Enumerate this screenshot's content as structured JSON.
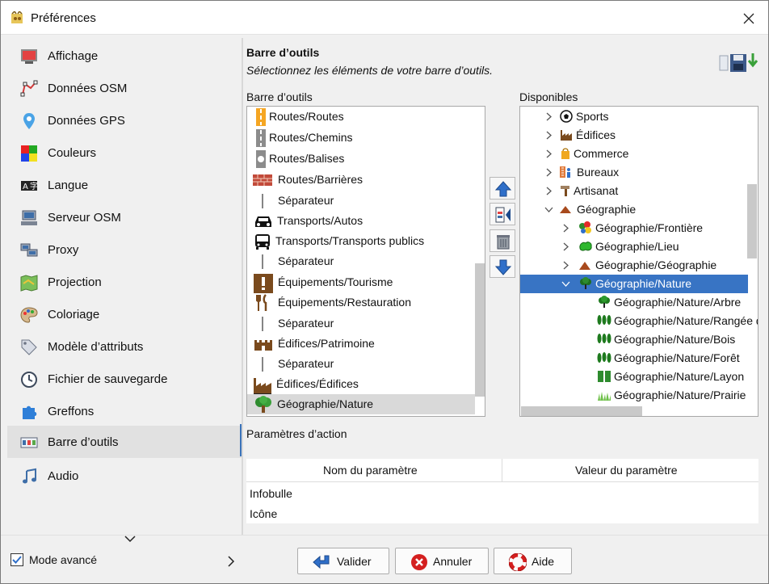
{
  "window": {
    "title": "Préférences"
  },
  "sidebar": {
    "items": [
      {
        "label": "Affichage",
        "icon": "display-icon"
      },
      {
        "label": "Données OSM",
        "icon": "osm-data-icon"
      },
      {
        "label": "Données GPS",
        "icon": "gps-pin-icon"
      },
      {
        "label": "Couleurs",
        "icon": "colors-icon"
      },
      {
        "label": "Langue",
        "icon": "language-icon"
      },
      {
        "label": "Serveur OSM",
        "icon": "server-icon"
      },
      {
        "label": "Proxy",
        "icon": "proxy-icon"
      },
      {
        "label": "Projection",
        "icon": "map-projection-icon"
      },
      {
        "label": "Coloriage",
        "icon": "palette-icon"
      },
      {
        "label": "Modèle d’attributs",
        "icon": "tag-icon"
      },
      {
        "label": "Fichier de sauvegarde",
        "icon": "clock-file-icon"
      },
      {
        "label": "Greffons",
        "icon": "puzzle-icon"
      },
      {
        "label": "Barre d’outils",
        "icon": "toolbar-icon",
        "selected": true
      },
      {
        "label": "Audio",
        "icon": "music-note-icon"
      }
    ]
  },
  "main": {
    "title": "Barre d’outils",
    "subtitle": "Sélectionnez les éléments de votre barre d’outils.",
    "toolbar_label": "Barre d’outils",
    "available_label": "Disponibles",
    "toolbar_items": [
      {
        "label": "Routes/Routes",
        "icon": "road-primary-icon"
      },
      {
        "label": "Routes/Chemins",
        "icon": "road-path-icon"
      },
      {
        "label": "Routes/Balises",
        "icon": "road-marker-icon"
      },
      {
        "label": "Routes/Barrières",
        "icon": "brick-wall-icon"
      },
      {
        "label": "Séparateur",
        "icon": "separator-icon"
      },
      {
        "label": "Transports/Autos",
        "icon": "car-icon"
      },
      {
        "label": "Transports/Transports publics",
        "icon": "bus-icon"
      },
      {
        "label": "Séparateur",
        "icon": "separator-icon"
      },
      {
        "label": "Équipements/Tourisme",
        "icon": "info-exclamation-icon"
      },
      {
        "label": "Équipements/Restauration",
        "icon": "restaurant-icon"
      },
      {
        "label": "Séparateur",
        "icon": "separator-icon"
      },
      {
        "label": "Édifices/Patrimoine",
        "icon": "castle-icon"
      },
      {
        "label": "Séparateur",
        "icon": "separator-icon"
      },
      {
        "label": "Édifices/Édifices",
        "icon": "factory-icon"
      },
      {
        "label": "Géographie/Nature",
        "icon": "tree-icon",
        "selected": true
      }
    ],
    "available_tree": [
      {
        "label": "Sports",
        "icon": "soccer-ball-icon",
        "level": 0,
        "expanded": false
      },
      {
        "label": "Édifices",
        "icon": "factory-icon",
        "level": 0,
        "expanded": false
      },
      {
        "label": "Commerce",
        "icon": "shopping-bag-icon",
        "level": 0,
        "expanded": false
      },
      {
        "label": "Bureaux",
        "icon": "office-icon",
        "level": 0,
        "expanded": false
      },
      {
        "label": "Artisanat",
        "icon": "hammer-icon",
        "level": 0,
        "expanded": false
      },
      {
        "label": "Géographie",
        "icon": "mountain-icon",
        "level": 0,
        "expanded": true
      },
      {
        "label": "Géographie/Frontière",
        "icon": "border-icon",
        "level": 1,
        "expanded": false
      },
      {
        "label": "Géographie/Lieu",
        "icon": "place-icon",
        "level": 1,
        "expanded": false
      },
      {
        "label": "Géographie/Géographie",
        "icon": "mountain-icon",
        "level": 1,
        "expanded": false
      },
      {
        "label": "Géographie/Nature",
        "icon": "tree-icon",
        "level": 1,
        "expanded": true,
        "selected": true
      },
      {
        "label": "Géographie/Nature/Arbre",
        "icon": "tree-icon",
        "level": 2
      },
      {
        "label": "Géographie/Nature/Rangée d’arbres",
        "icon": "tree-row-icon",
        "level": 2
      },
      {
        "label": "Géographie/Nature/Bois",
        "icon": "wood-icon",
        "level": 2
      },
      {
        "label": "Géographie/Nature/Forêt",
        "icon": "forest-icon",
        "level": 2
      },
      {
        "label": "Géographie/Nature/Layon",
        "icon": "cutline-icon",
        "level": 2
      },
      {
        "label": "Géographie/Nature/Prairie",
        "icon": "grass-icon",
        "level": 2
      }
    ],
    "params_label": "Paramètres d’action",
    "params_columns": [
      "Nom du paramètre",
      "Valeur du paramètre"
    ],
    "params_rows": [
      "Infobulle",
      "Icône"
    ]
  },
  "footer": {
    "mode_label": "Mode avancé",
    "mode_checked": true,
    "validate_label": "Valider",
    "cancel_label": "Annuler",
    "help_label": "Aide"
  },
  "colors": {
    "selection": "#3874c4",
    "accent": "#3b73b9"
  }
}
